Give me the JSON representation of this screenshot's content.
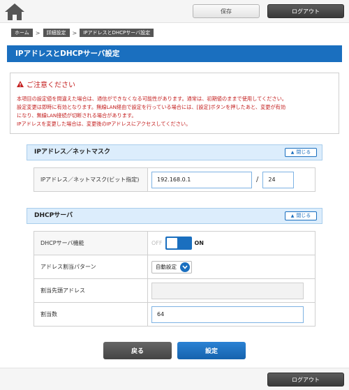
{
  "header": {
    "home_icon": "home-icon",
    "save_label": "保存",
    "logout_label": "ログアウト"
  },
  "breadcrumb": [
    "ホーム",
    "詳細設定",
    "IPアドレスとDHCPサーバ設定"
  ],
  "page_title": "IPアドレスとDHCPサーバ設定",
  "notice": {
    "title": "ご注意ください",
    "lines": [
      "本項目の設定値を間違えた場合は、通信ができなくなる可能性があります。通常は、初期値のままで使用してください。",
      "設定変更は即時に有効となります。無線LAN経由で設定を行っている場合には、[設定]ボタンを押したあと、変更が有効",
      "になり、無線LAN接続が切断される場合があります。",
      "IPアドレスを変更した場合は、変更後のIPアドレスにアクセスしてください。"
    ]
  },
  "ip_section": {
    "title": "IPアドレス／ネットマスク",
    "close_label": "閉じる",
    "row_label": "IPアドレス／ネットマスク(ビット指定)",
    "ip_value": "192.168.0.1",
    "separator": "/",
    "mask_value": "24"
  },
  "dhcp_section": {
    "title": "DHCPサーバ",
    "close_label": "閉じる",
    "function_label": "DHCPサーバ機能",
    "toggle_off": "OFF",
    "toggle_on": "ON",
    "toggle_state": "on",
    "pattern_label": "アドレス割当パターン",
    "pattern_value": "自動設定",
    "start_label": "割当先頭アドレス",
    "start_value": "",
    "count_label": "割当数",
    "count_value": "64"
  },
  "footer": {
    "back_label": "戻る",
    "apply_label": "設定",
    "logout_label": "ログアウト"
  },
  "colors": {
    "accent": "#1a6fbf",
    "warning": "#c42020",
    "section_bg": "#dcedfc"
  }
}
